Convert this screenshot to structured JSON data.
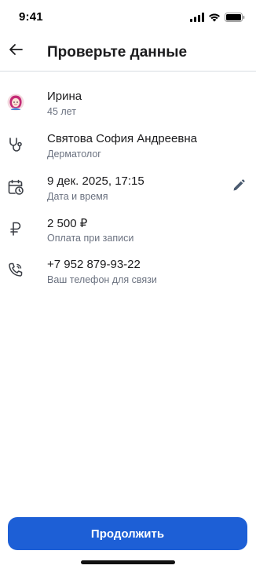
{
  "status_bar": {
    "time": "9:41"
  },
  "header": {
    "title": "Проверьте данные"
  },
  "rows": [
    {
      "title": "Ирина",
      "subtitle": "45 лет",
      "icon": "patient-avatar-icon"
    },
    {
      "title": "Святова София Андреевна",
      "subtitle": "Дерматолог",
      "icon": "stethoscope-icon"
    },
    {
      "title": "9 дек. 2025, 17:15",
      "subtitle": "Дата и время",
      "icon": "calendar-clock-icon"
    },
    {
      "title": "2 500 ₽",
      "subtitle": "Оплата при записи",
      "icon": "ruble-icon"
    },
    {
      "title": "+7 952 879-93-22",
      "subtitle": "Ваш телефон для связи",
      "icon": "phone-icon"
    }
  ],
  "actions": {
    "continue_label": "Продолжить"
  },
  "colors": {
    "accent": "#1d5fd6",
    "icon": "#3b3f46",
    "edit_icon": "#4b5b70",
    "subtitle": "#6b7280"
  }
}
